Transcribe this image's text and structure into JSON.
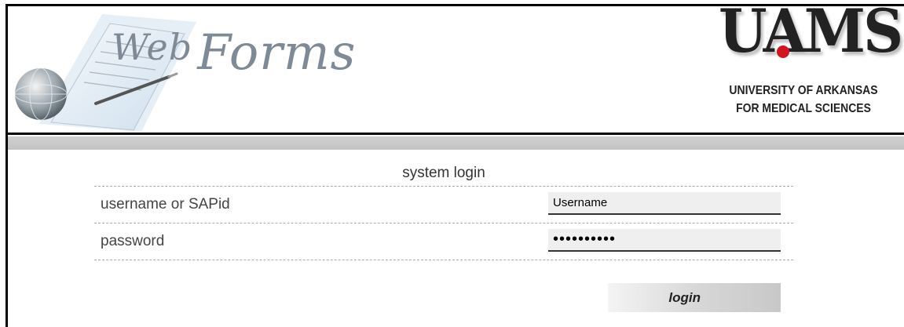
{
  "header": {
    "app_logo": {
      "word1": "Web",
      "word2": "Forms",
      "icon": "webforms-globe-paper-icon"
    },
    "institution_logo": {
      "acronym": "UAMS",
      "acronym_dot_color": "#d4141e",
      "line1": "UNIVERSITY OF ARKANSAS",
      "line2": "FOR MEDICAL SCIENCES"
    }
  },
  "login_form": {
    "title": "system login",
    "username_label": "username or SAPid",
    "username_value": "Username",
    "password_label": "password",
    "password_value": "••••••••••",
    "submit_label": "login"
  },
  "colors": {
    "band": "#c8c8c8",
    "input_bg": "#efefef",
    "border": "#000000"
  }
}
